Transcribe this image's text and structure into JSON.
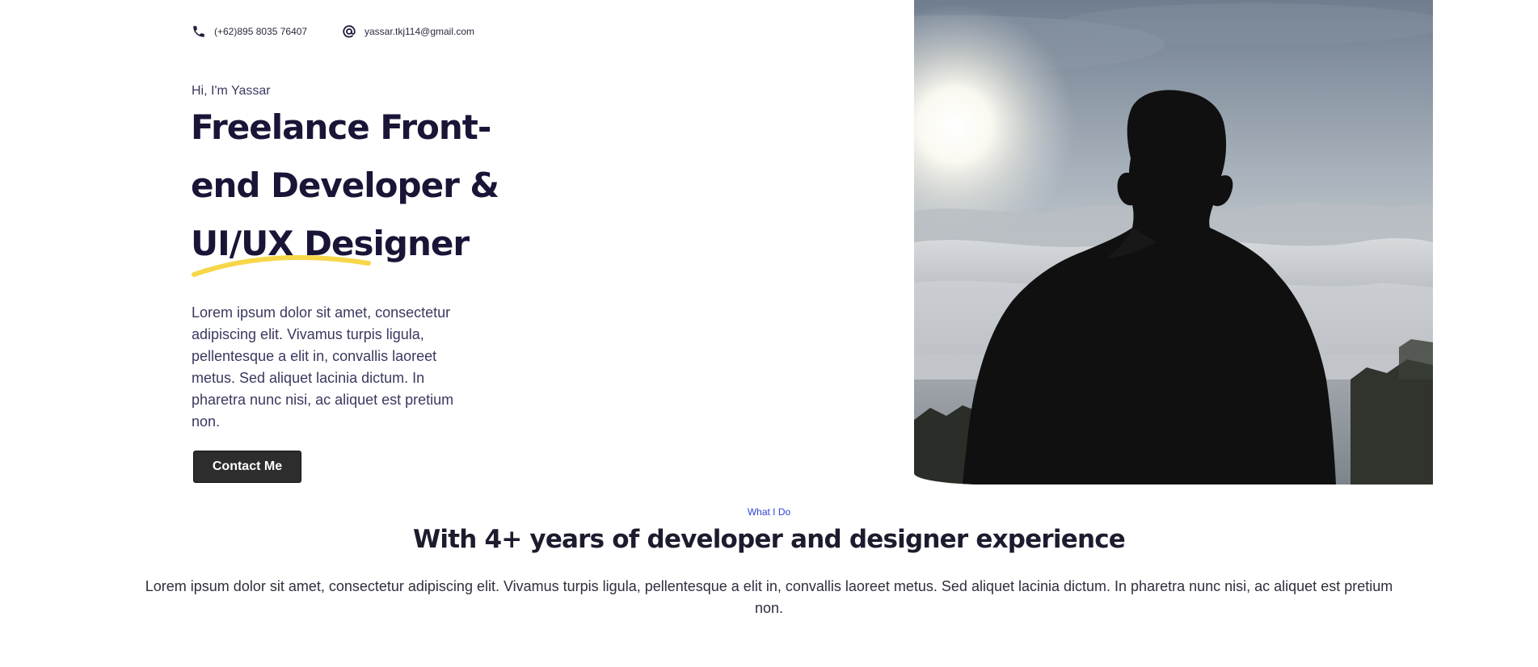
{
  "contact": {
    "phone": "(+62)895 8035 76407",
    "email": "yassar.tkj114@gmail.com",
    "phone_icon": "phone-icon",
    "email_icon": "at-sign-icon"
  },
  "hero": {
    "greeting": "Hi, I'm Yassar",
    "title_lines": [
      "Freelance Front-",
      "end Developer &",
      "UI/UX Designer"
    ],
    "description": "Lorem ipsum dolor sit amet, consectetur adipiscing elit. Vivamus turpis ligula, pellentesque a elit in, convallis laoreet metus. Sed aliquet lacinia dictum. In pharetra nunc nisi, ac aliquet est pretium non.",
    "cta_label": "Contact Me",
    "accent_color": "#f7d74a"
  },
  "services": {
    "eyebrow": "What I Do",
    "title": "With 4+ years of developer and designer experience",
    "description": "Lorem ipsum dolor sit amet, consectetur adipiscing elit. Vivamus turpis ligula, pellentesque a elit in, convallis laoreet metus. Sed aliquet lacinia dictum. In pharetra nunc nisi, ac aliquet est pretium non."
  },
  "colors": {
    "heading": "#1a1437",
    "eyebrow": "#2f44d6",
    "button_bg": "#2d2d2d"
  }
}
